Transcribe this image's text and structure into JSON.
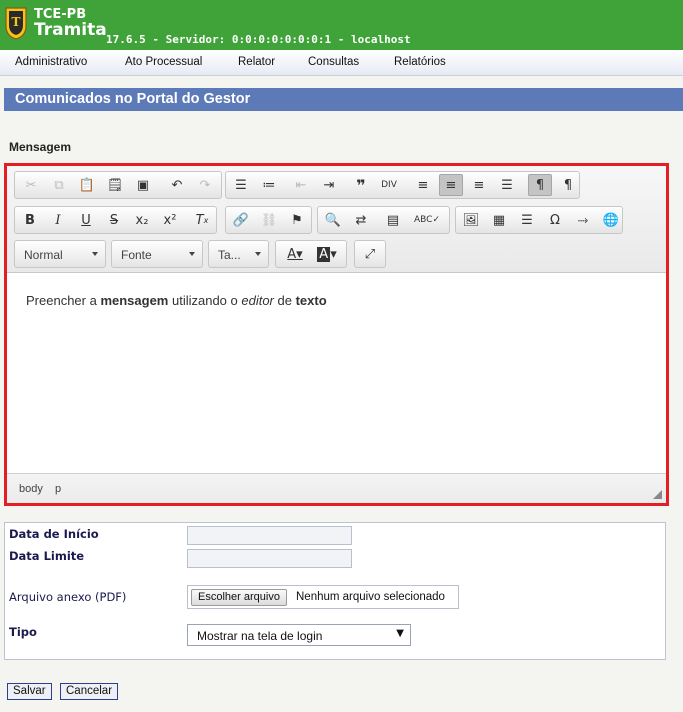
{
  "header": {
    "brand_top": "TCE-PB",
    "brand_main": "Tramita",
    "version": "17.6.5 - Servidor: 0:0:0:0:0:0:0:1 - localhost",
    "bg_color": "#3fa33a"
  },
  "menu": {
    "items": [
      "Administrativo",
      "Ato Processual",
      "Relator",
      "Consultas",
      "Relatórios"
    ]
  },
  "page": {
    "title": "Comunicados no Portal do Gestor",
    "title_bg": "#5c79b8"
  },
  "editor": {
    "section_label": "Mensagem",
    "border_color": "#e41e25",
    "toolbar_icons": [
      "cut-icon",
      "copy-icon",
      "paste-icon",
      "paste-text-icon",
      "paste-word-icon",
      "undo-icon",
      "redo-icon",
      "numbered-list-icon",
      "bulleted-list-icon",
      "outdent-icon",
      "indent-icon",
      "blockquote-icon",
      "div-icon",
      "align-left-icon",
      "align-center-icon",
      "align-right-icon",
      "justify-icon",
      "ltr-icon",
      "rtl-icon",
      "bold-icon",
      "italic-icon",
      "underline-icon",
      "strike-icon",
      "subscript-icon",
      "superscript-icon",
      "remove-format-icon",
      "link-icon",
      "unlink-icon",
      "anchor-icon",
      "find-icon",
      "replace-icon",
      "select-all-icon",
      "spellcheck-icon",
      "image-icon",
      "table-icon",
      "horizontal-rule-icon",
      "special-char-icon",
      "page-break-icon",
      "iframe-icon",
      "text-color-icon",
      "bg-color-icon",
      "maximize-icon"
    ],
    "combos": {
      "format": "Normal",
      "font": "Fonte",
      "size": "Ta..."
    },
    "content": {
      "t1": "Preencher a ",
      "b1": "mensagem",
      "t2": " utilizando o ",
      "i1": "editor",
      "t3": " de ",
      "b2": "texto"
    },
    "path": [
      "body",
      "p"
    ]
  },
  "form": {
    "data_inicio_label": "Data de Início",
    "data_inicio_value": "",
    "data_limite_label": "Data Limite",
    "data_limite_value": "",
    "arquivo_label": "Arquivo anexo (PDF)",
    "arquivo_button": "Escolher arquivo",
    "arquivo_status": "Nenhum arquivo selecionado",
    "tipo_label": "Tipo",
    "tipo_value": "Mostrar na tela de login"
  },
  "actions": {
    "save": "Salvar",
    "cancel": "Cancelar"
  }
}
